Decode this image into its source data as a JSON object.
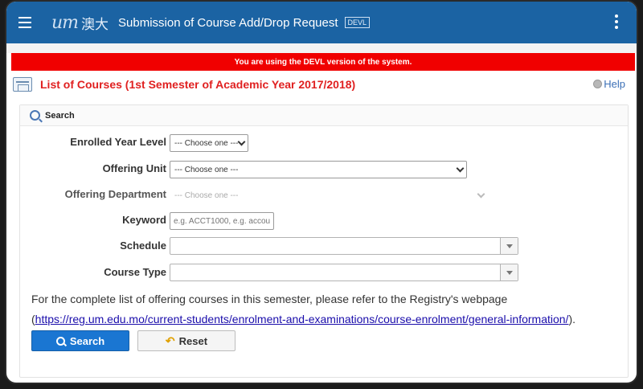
{
  "header": {
    "logo_text": "um",
    "logo_cn": "澳大",
    "title": "Submission of Course Add/Drop Request",
    "env_badge": "DEVL"
  },
  "banner": {
    "text": "You are using the DEVL version of the system."
  },
  "page": {
    "title": "List of Courses (1st Semester of Academic Year 2017/2018)",
    "help_label": "Help"
  },
  "search_panel": {
    "title": "Search",
    "fields": {
      "year_level": {
        "label": "Enrolled Year Level",
        "value": "--- Choose one ---"
      },
      "offering_unit": {
        "label": "Offering Unit",
        "value": "--- Choose one ---"
      },
      "offering_department": {
        "label": "Offering Department",
        "value": "--- Choose one ---"
      },
      "keyword": {
        "label": "Keyword",
        "placeholder": "e.g. ACCT1000, e.g. accou"
      },
      "schedule": {
        "label": "Schedule",
        "value": ""
      },
      "course_type": {
        "label": "Course Type",
        "value": ""
      }
    },
    "note_line1": "For the complete list of offering courses in this semester, please refer to the Registry's webpage",
    "note_open": "(",
    "note_link": "https://reg.um.edu.mo/current-students/enrolment-and-examinations/course-enrolment/general-information/",
    "note_close": ").",
    "search_button": "Search",
    "reset_button": "Reset"
  },
  "colors": {
    "header_bg": "#1b63a3",
    "banner_bg": "#f00000",
    "title_red": "#e02020",
    "button_blue": "#1a76d2"
  }
}
